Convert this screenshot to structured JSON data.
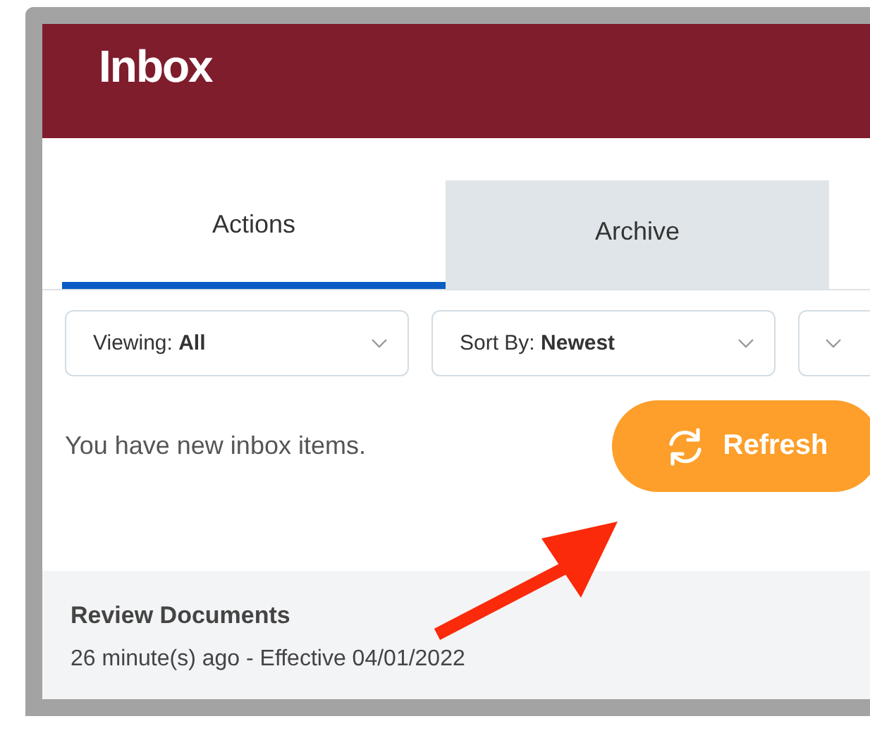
{
  "header": {
    "title": "Inbox"
  },
  "tabs": [
    {
      "label": "Actions",
      "selected": true
    },
    {
      "label": "Archive",
      "selected": false
    }
  ],
  "filters": [
    {
      "label": "Viewing: **All**"
    },
    {
      "label": "Sort By: **Newest**"
    }
  ],
  "notice": {
    "message": "You have new inbox items.",
    "button": "Refresh"
  },
  "items": [
    {
      "title": "Review Documents",
      "subtitle": "26 minute(s) ago - Effective 04/01/2022"
    }
  ]
}
